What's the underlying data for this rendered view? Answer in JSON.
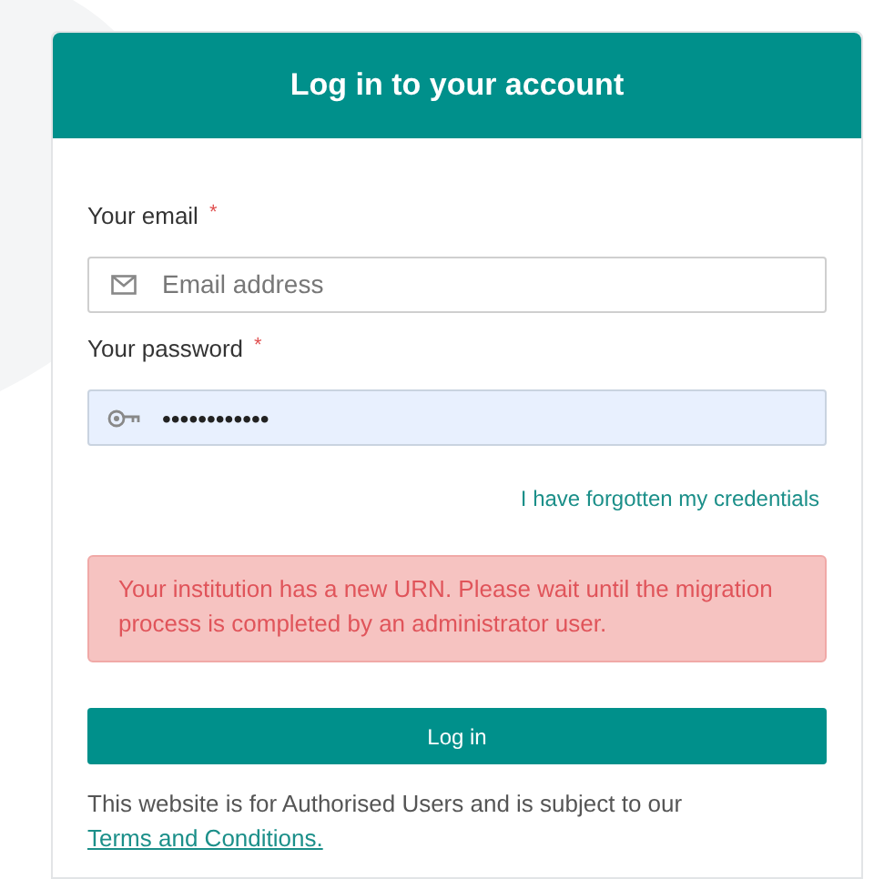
{
  "header": {
    "title": "Log in to your account"
  },
  "fields": [
    {
      "kind": "email",
      "label": "Your email",
      "required": true,
      "required_mark": "*",
      "placeholder": "Email address",
      "focused": false
    },
    {
      "kind": "password",
      "label": "Your password",
      "required": true,
      "required_mark": "*",
      "value": "••••••••••••",
      "focused": true
    }
  ],
  "forgot_link": "I have forgotten my credentials",
  "alert": "Your institution has a new URN. Please wait until the migration process is completed by an administrator user.",
  "submit": "Log in",
  "footer": {
    "text": "This website is for Authorised Users and is subject to our",
    "link": "Terms and Conditions."
  }
}
